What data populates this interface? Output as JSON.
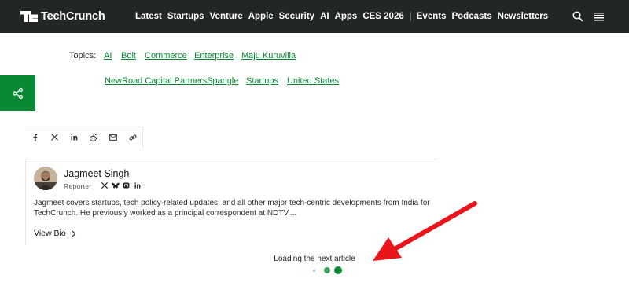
{
  "header": {
    "logo_mark": "TC",
    "logo_text": "TechCrunch",
    "nav": [
      "Latest",
      "Startups",
      "Venture",
      "Apple",
      "Security",
      "AI",
      "Apps",
      "CES 2026"
    ],
    "nav_secondary": [
      "Events",
      "Podcasts",
      "Newsletters"
    ],
    "icons": [
      "search-icon",
      "menu-icon"
    ]
  },
  "topics": {
    "label": "Topics:",
    "tags": [
      "AI",
      "Bolt",
      "Commerce",
      "Enterprise",
      "Maju Kuruvilla",
      "NewRoad Capital Partners",
      "Spangle",
      "Startups",
      "United States"
    ]
  },
  "share": {
    "icon": "share-icon"
  },
  "social_share": [
    "facebook-icon",
    "x-icon",
    "linkedin-icon",
    "reddit-icon",
    "email-icon",
    "link-icon"
  ],
  "author": {
    "name": "Jagmeet Singh",
    "role": "Reporter",
    "socials": [
      "x-icon",
      "bluesky-icon",
      "mastodon-icon",
      "linkedin-icon"
    ],
    "bio": "Jagmeet covers startups, tech policy-related updates, and all other major tech-centric developments from India for TechCrunch. He previously worked as a principal correspondent at NDTV....",
    "view_bio": "View Bio"
  },
  "loading": {
    "text": "Loading the next article",
    "dots": 3,
    "active_dot": 3
  },
  "colors": {
    "topbar": "#222624",
    "accent": "#0a8935",
    "annotation_arrow": "#e8151b"
  }
}
